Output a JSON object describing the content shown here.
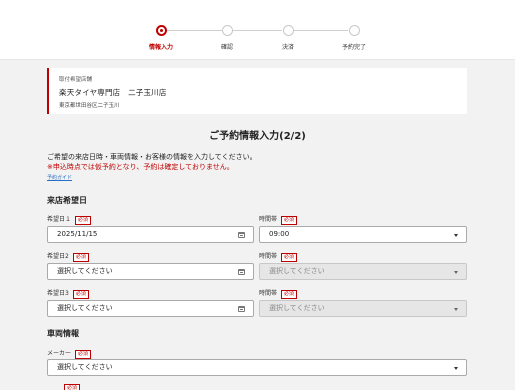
{
  "steps": [
    {
      "label": "情報入力",
      "active": true
    },
    {
      "label": "確認",
      "active": false
    },
    {
      "label": "決済",
      "active": false
    },
    {
      "label": "予約完了",
      "active": false
    }
  ],
  "store": {
    "caption": "取付希望店舗",
    "name": "楽天タイヤ専門店　二子玉川店",
    "address": "東京都世田谷区二子玉川"
  },
  "page_title": "ご予約情報入力(2/2)",
  "intro": {
    "line1": "ご希望の来店日時・車両情報・お客様の情報を入力してください。",
    "warning": "※申込時点では仮予約となり、予約は確定しておりません。",
    "guide_link": "予約ガイド"
  },
  "visit_section": {
    "title": "来店希望日",
    "required_badge": "必須",
    "rows": [
      {
        "date_label": "希望日１",
        "date_value": "2025/11/15",
        "time_label": "時間帯",
        "time_value": "09:00",
        "time_disabled": false
      },
      {
        "date_label": "希望日2",
        "date_value": "選択してください",
        "time_label": "時間帯",
        "time_value": "選択してください",
        "time_disabled": true
      },
      {
        "date_label": "希望日3",
        "date_value": "選択してください",
        "time_label": "時間帯",
        "time_value": "選択してください",
        "time_disabled": true
      }
    ]
  },
  "vehicle_section": {
    "title": "車両情報",
    "maker_label": "メーカー",
    "maker_value": "選択してください"
  },
  "colors": {
    "accent": "#bf0000",
    "link": "#2a6fc4",
    "background": "#f2f2f2"
  }
}
